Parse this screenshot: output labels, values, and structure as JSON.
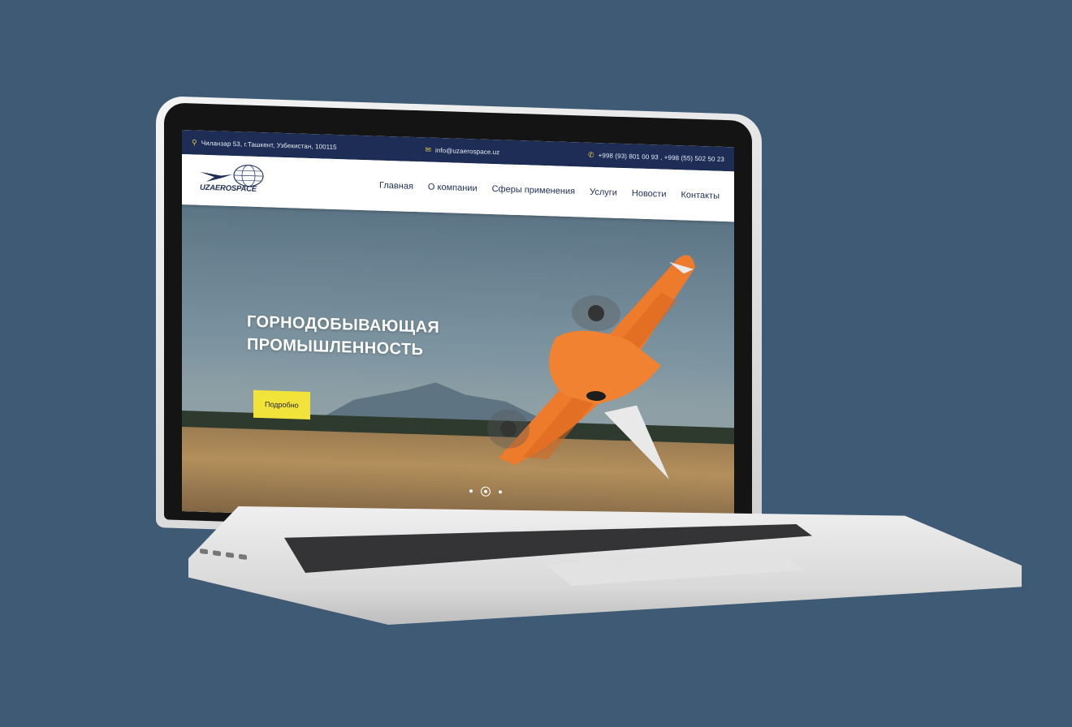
{
  "topbar": {
    "address": "Чиланзар 53, г.Ташкент, Узбекистан, 100115",
    "email": "info@uzaerospace.uz",
    "phones": "+998 (93) 801 00 93 ,  +998 (55) 502 50 23",
    "address_icon": "map-pin-icon",
    "email_icon": "envelope-icon",
    "phone_icon": "phone-icon"
  },
  "header": {
    "logo_text": "UZAEROSPACE",
    "nav": [
      "Главная",
      "О компании",
      "Сферы применения",
      "Услуги",
      "Новости",
      "Контакты"
    ]
  },
  "hero": {
    "title_line1": "ГОРНОДОБЫВАЮЩАЯ",
    "title_line2": "ПРОМЫШЛЕННОСТЬ",
    "button_label": "Подробно",
    "slides_total": 3,
    "active_slide": 2
  },
  "colors": {
    "background": "#3f5a74",
    "topbar": "#1d2d55",
    "accent_yellow": "#f2e33a",
    "drone_orange": "#ee7a2c"
  }
}
